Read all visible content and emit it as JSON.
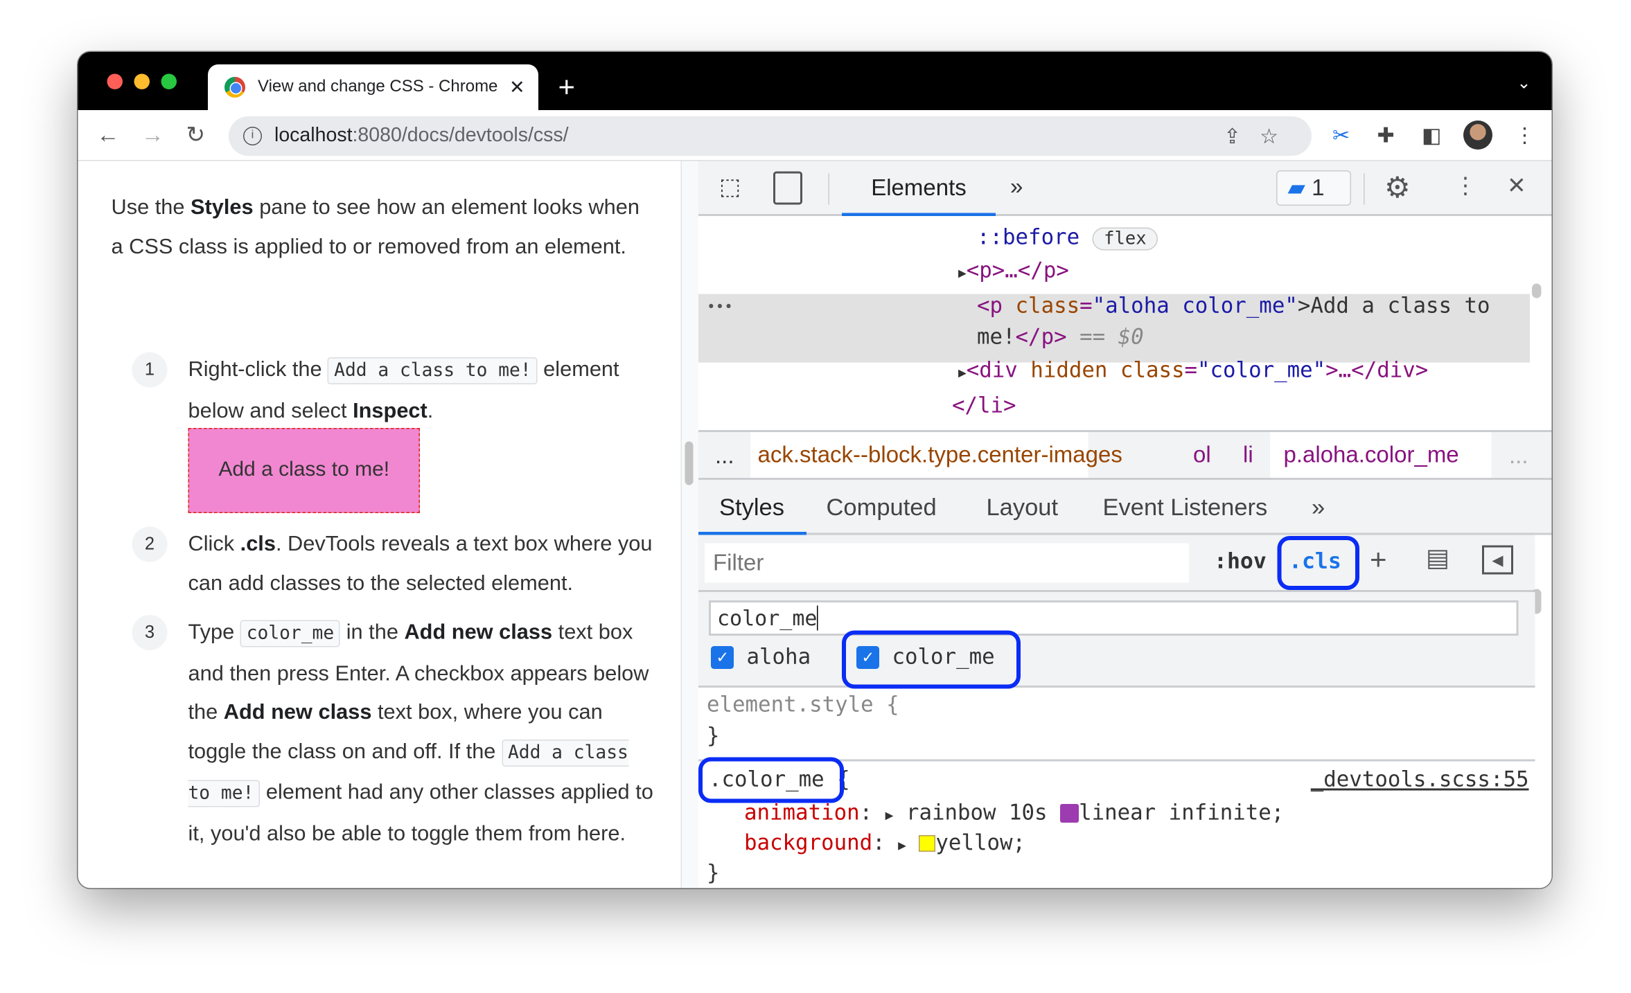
{
  "browser": {
    "tab_title": "View and change CSS - Chrome",
    "url_host": "localhost",
    "url_path": ":8080/docs/devtools/css/"
  },
  "page": {
    "intro": [
      "Use the ",
      "Styles",
      " pane to see how an element looks when a CSS class is applied to or removed from an element."
    ],
    "steps": [
      {
        "num": "1",
        "a": "Right-click the ",
        "code": "Add a class to me!",
        "b": " element below and select ",
        "bold": "Inspect",
        "c": "."
      },
      {
        "num": "2",
        "a": "Click ",
        "bold": ".cls",
        "b": ". DevTools reveals a text box where you can add classes to the selected element."
      },
      {
        "num": "3",
        "a": "Type ",
        "code": "color_me",
        "b": " in the ",
        "bold": "Add new class",
        "c": " text box and then press Enter. A checkbox appears below the ",
        "bold2": "Add new class",
        "d": " text box, where you can toggle the class on and off. If the ",
        "code2": "Add a class to me!",
        "e": " element had any other classes applied to it, you'd also be able to toggle them from here."
      }
    ],
    "demo_box": "Add a class to me!"
  },
  "devtools": {
    "main_tab": "Elements",
    "issues_count": "1",
    "dom": {
      "before": "::before",
      "flex_badge": "flex",
      "p_collapsed": "<p>…</p>",
      "p_open": "<p",
      "class_attr": "class",
      "class_val": "\"aloha color_me\"",
      "p_text": ">Add a class to",
      "p_text2": "me!",
      "p_close": "</p>",
      "eq": " == $0",
      "div_open": "<div",
      "hidden": "hidden",
      "div_class_val": "\"color_me\"",
      "div_rest": ">…</div>",
      "li_close": "</li>",
      "ellipsis": "•••"
    },
    "breadcrumbs": [
      "...",
      "ack.stack--block.type.center-images",
      "ol",
      "li",
      "p.aloha.color_me",
      "..."
    ],
    "panel_tabs": [
      "Styles",
      "Computed",
      "Layout",
      "Event Listeners"
    ],
    "filter_placeholder": "Filter",
    "hov": ":hov",
    "cls": ".cls",
    "new_class_value": "color_me",
    "classes": [
      {
        "name": "aloha",
        "checked": true
      },
      {
        "name": "color_me",
        "checked": true
      }
    ],
    "element_style": "element.style {",
    "close_brace": "}",
    "rule": {
      "selector": ".color_me",
      "open": " {",
      "source": "_devtools.scss:55",
      "decls": [
        {
          "prop": "animation",
          "value_a": "rainbow 10s ",
          "value_b": "linear infinite;"
        },
        {
          "prop": "background",
          "value_a": "yellow;"
        }
      ]
    },
    "colors": {
      "highlight": "#0a2cf5",
      "swatch": "#ffff00",
      "accent": "#1a73e8"
    }
  }
}
